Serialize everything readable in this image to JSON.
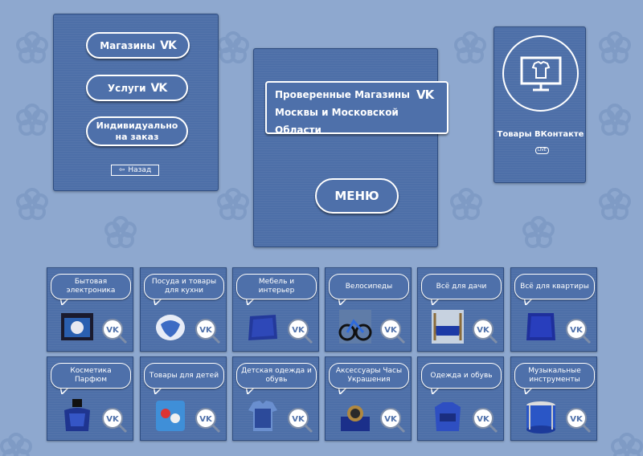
{
  "left_menu": {
    "stores_label": "Магазины",
    "services_label": "Услуги",
    "custom_label_line1": "Индивидуально",
    "custom_label_line2": "на заказ",
    "back_label": "Назад"
  },
  "center": {
    "title_line1": "Проверенные Магазины",
    "title_line2": "Москвы и Московской Области",
    "menu_label": "МЕНЮ"
  },
  "side_card": {
    "title": "Товары ВКонтакте",
    "badge": "LIVE"
  },
  "vk_mark": "VK",
  "categories": [
    {
      "label": "Бытовая электроника",
      "icon": "electronics-product-icon"
    },
    {
      "label": "Посуда и товары для кухни",
      "icon": "kitchenware-product-icon"
    },
    {
      "label": "Мебель и интерьер",
      "icon": "furniture-product-icon"
    },
    {
      "label": "Велосипеды",
      "icon": "bicycle-product-icon"
    },
    {
      "label": "Всё для дачи",
      "icon": "garden-product-icon"
    },
    {
      "label": "Всё для квартиры",
      "icon": "apartment-product-icon"
    },
    {
      "label": "Косметика Парфюм",
      "icon": "perfume-product-icon"
    },
    {
      "label": "Товары для детей",
      "icon": "kids-product-icon"
    },
    {
      "label": "Детская одежда и обувь",
      "icon": "kids-clothing-product-icon"
    },
    {
      "label": "Аксессуары Часы Украшения",
      "icon": "watch-product-icon"
    },
    {
      "label": "Одежда и обувь",
      "icon": "clothing-product-icon"
    },
    {
      "label": "Музыкальные инструменты",
      "icon": "drum-product-icon"
    }
  ],
  "colors": {
    "background": "#8ea8cf",
    "panel": "#4d6fa8",
    "border": "#ffffff"
  }
}
